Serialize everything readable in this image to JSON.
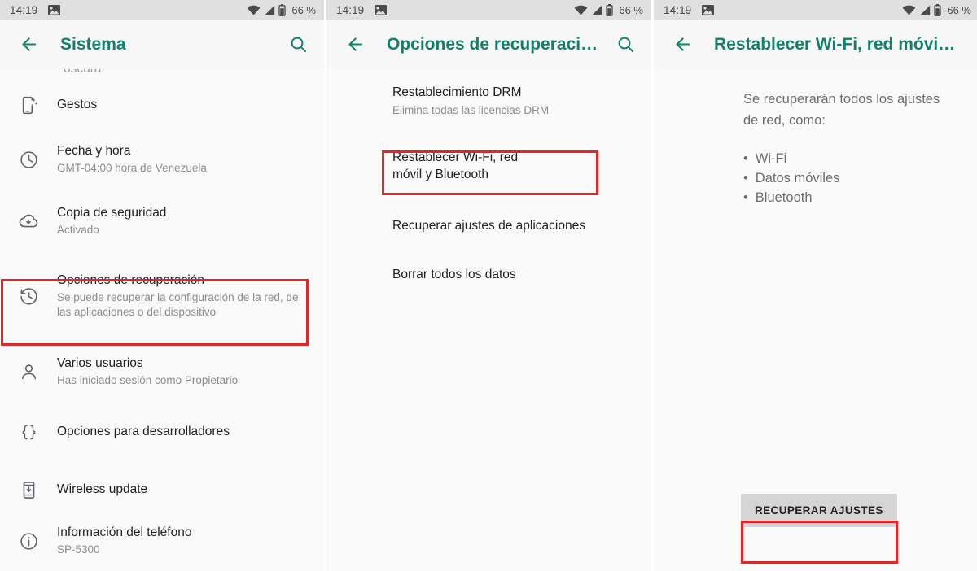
{
  "status_bar": {
    "time": "14:19",
    "battery_percent": "66 %",
    "icons": [
      "image-notification-icon",
      "wifi-icon",
      "cellular-signal-icon",
      "battery-icon"
    ]
  },
  "colors": {
    "accent_teal": "#13806a",
    "highlight_red": "#e02626",
    "statusbar_bg": "#e0e0e0",
    "appbar_bg": "#f7f7f7",
    "content_bg": "#fafafa",
    "button_bg": "#d5d5d5"
  },
  "screens": [
    {
      "id": "system-settings",
      "appbar": {
        "title": "Sistema",
        "back_icon": "arrow-left-icon",
        "search_icon": "search-icon",
        "has_search": true
      },
      "partial_top_text": "oscura",
      "items": [
        {
          "icon": "gesture-phone-icon",
          "title": "Gestos",
          "subtitle": "",
          "highlighted": false
        },
        {
          "icon": "clock-icon",
          "title": "Fecha y hora",
          "subtitle": "GMT-04:00 hora de Venezuela",
          "highlighted": false
        },
        {
          "icon": "cloud-backup-icon",
          "title": "Copia de seguridad",
          "subtitle": "Activado",
          "highlighted": false
        },
        {
          "icon": "restore-history-icon",
          "title": "Opciones de recuperación",
          "subtitle": "Se puede recuperar la configuración de la red, de las aplicaciones o del dispositivo",
          "highlighted": true
        },
        {
          "icon": "person-icon",
          "title": "Varios usuarios",
          "subtitle": "Has iniciado sesión como Propietario",
          "highlighted": false
        },
        {
          "icon": "braces-icon",
          "title": "Opciones para desarrolladores",
          "subtitle": "",
          "highlighted": false
        },
        {
          "icon": "phone-download-icon",
          "title": "Wireless update",
          "subtitle": "",
          "highlighted": false
        },
        {
          "icon": "info-circle-icon",
          "title": "Información del teléfono",
          "subtitle": "SP-5300",
          "highlighted": false
        }
      ]
    },
    {
      "id": "reset-options",
      "appbar": {
        "title": "Opciones de recuperaci…",
        "back_icon": "arrow-left-icon",
        "search_icon": "search-icon",
        "has_search": true
      },
      "items": [
        {
          "title": "Restablecimiento DRM",
          "subtitle": "Elimina todas las licencias DRM",
          "highlighted": false
        },
        {
          "title": "Restablecer Wi-Fi, red móvil y Bluetooth",
          "subtitle": "",
          "highlighted": true
        },
        {
          "title": "Recuperar ajustes de aplicaciones",
          "subtitle": "",
          "highlighted": false
        },
        {
          "title": "Borrar todos los datos",
          "subtitle": "",
          "highlighted": false
        }
      ]
    },
    {
      "id": "reset-network",
      "appbar": {
        "title": "Restablecer Wi-Fi, red móvi…",
        "back_icon": "arrow-left-icon",
        "search_icon": "search-icon",
        "has_search": false
      },
      "description": "Se recuperarán todos los ajustes de red, como:",
      "bullets": [
        "Wi-Fi",
        "Datos móviles",
        "Bluetooth"
      ],
      "button_label": "RECUPERAR AJUSTES",
      "button_highlighted": true
    }
  ]
}
